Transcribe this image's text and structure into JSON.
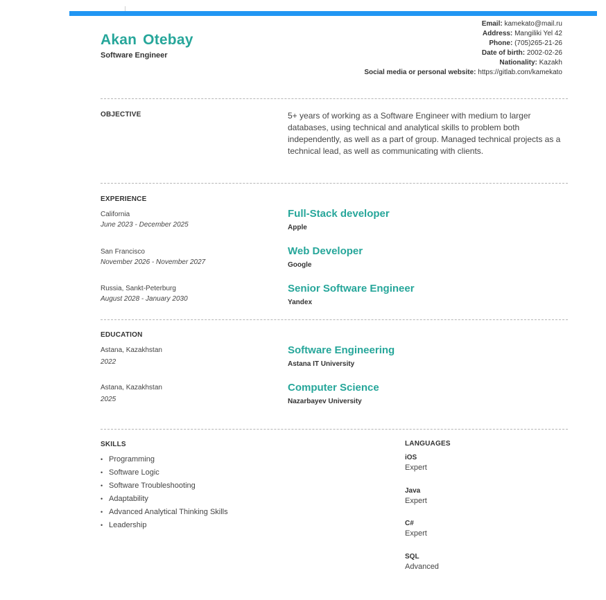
{
  "header": {
    "name": "Akan  Otebay",
    "role": "Software Engineer"
  },
  "contact": [
    {
      "label": "Email:",
      "value": "kamekato@mail.ru"
    },
    {
      "label": "Address:",
      "value": "Mangiliki Yel 42"
    },
    {
      "label": "Phone:",
      "value": "(705)265-21-26"
    },
    {
      "label": "Date of birth:",
      "value": "2002-02-26"
    },
    {
      "label": "Nationality:",
      "value": "Kazakh"
    },
    {
      "label": "Social media or personal website:",
      "value": "https://gitlab.com/kamekato"
    }
  ],
  "objective": {
    "title": "OBJECTIVE",
    "text": "5+ years of working as a Software Engineer with medium to larger databases, using technical and analytical skills to problem both independently, as well as a part of group. Managed technical projects as a technical lead, as well as communicating with clients."
  },
  "experience": {
    "title": "EXPERIENCE",
    "items": [
      {
        "location": "California",
        "dates": "June 2023 - December 2025",
        "position": "Full-Stack developer",
        "company": "Apple"
      },
      {
        "location": "San Francisco",
        "dates": "November 2026 - November 2027",
        "position": "Web Developer",
        "company": "Google"
      },
      {
        "location": "Russia, Sankt-Peterburg",
        "dates": "August 2028 - January 2030",
        "position": "Senior Software Engineer",
        "company": "Yandex"
      }
    ]
  },
  "education": {
    "title": "EDUCATION",
    "items": [
      {
        "location": "Astana, Kazakhstan",
        "year": "2022",
        "degree": "Software Engineering",
        "school": "Astana IT University"
      },
      {
        "location": "Astana, Kazakhstan",
        "year": "2025",
        "degree": "Computer Science",
        "school": "Nazarbayev University"
      }
    ]
  },
  "skills": {
    "title": "SKILLS",
    "bullet": "•",
    "items": [
      "Programming",
      "Software Logic",
      "Software Troubleshooting",
      "Adaptability",
      "Advanced Analytical Thinking Skills",
      "Leadership"
    ]
  },
  "languages": {
    "title": "LANGUAGES",
    "items": [
      {
        "name": "iOS",
        "level": "Expert"
      },
      {
        "name": "Java",
        "level": "Expert"
      },
      {
        "name": "C#",
        "level": "Expert"
      },
      {
        "name": "SQL",
        "level": "Advanced"
      }
    ]
  },
  "colors": {
    "accent": "#26a69a",
    "topbar": "#2196f3",
    "text": "#333333"
  }
}
